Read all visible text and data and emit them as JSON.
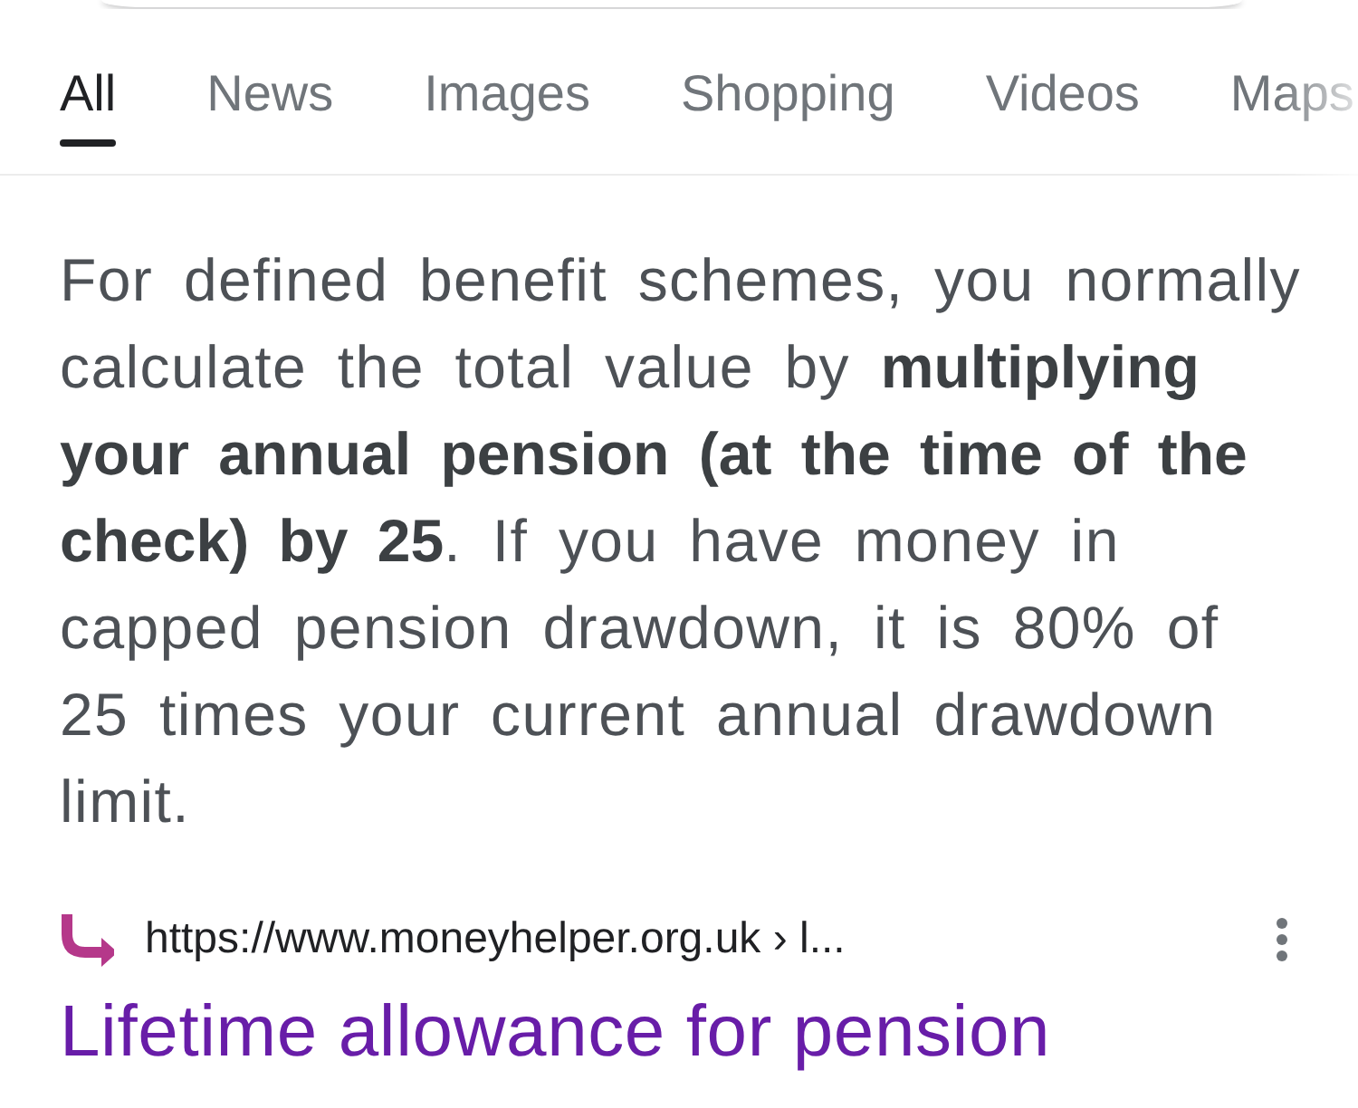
{
  "tabs": [
    {
      "label": "All",
      "selected": true
    },
    {
      "label": "News",
      "selected": false
    },
    {
      "label": "Images",
      "selected": false
    },
    {
      "label": "Shopping",
      "selected": false
    },
    {
      "label": "Videos",
      "selected": false
    },
    {
      "label": "Maps",
      "selected": false
    }
  ],
  "answer": {
    "text": "For defined benefit schemes, you normally calculate the total value by **multiplying your annual pension (at the time of the check) by 25**. If you have money in capped pension drawdown, it is 80% of 25 times your current annual drawdown limit."
  },
  "result": {
    "url": "https://www.moneyhelper.org.uk › l...",
    "title": "Lifetime allowance for pension",
    "visited": true
  }
}
